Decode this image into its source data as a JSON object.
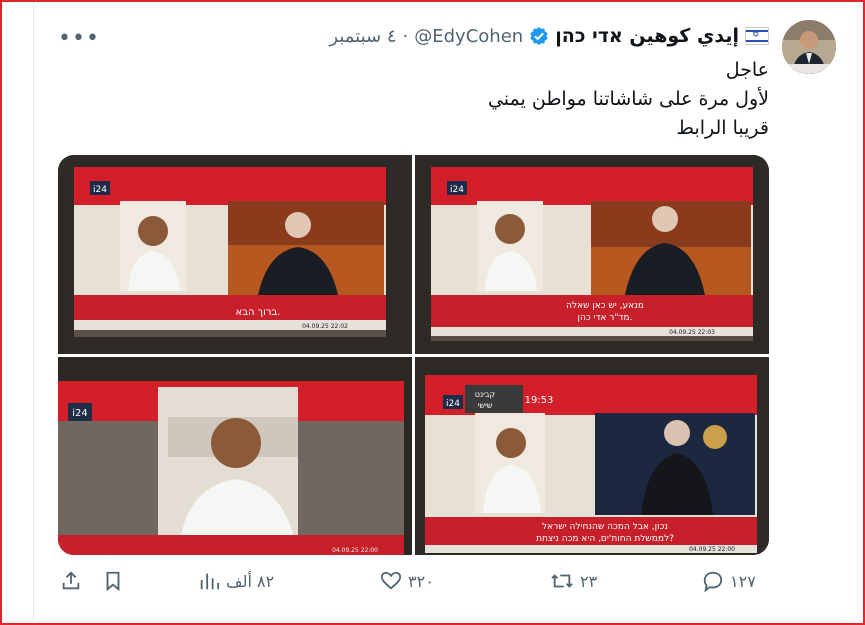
{
  "tweet": {
    "display_name": "إيدي كوهين אדי כהן",
    "handle": "@EdyCohen",
    "separator": "·",
    "date": "٤ سبتمبر",
    "lines": [
      "عاجل",
      "لأول مرة على شاشاتنا مواطن يمني",
      "قريبا الرابط"
    ]
  },
  "media": {
    "tiles": [
      {
        "logo": "i24",
        "caption": "ברוך הבא.",
        "ticker": "04.09.25   22:02"
      },
      {
        "logo": "i24",
        "caption_line1": "מנאע, יש כאן שאלה",
        "caption_line2": "מד\"ר אדי כהן.",
        "ticker": "04.09.25   22:03"
      },
      {
        "logo": "i24",
        "caption": "",
        "ticker": "04.09.25   22:00"
      },
      {
        "logo": "i24",
        "badge_line1": "קבינט",
        "badge_line2": "שישי",
        "badge_time": "19:53",
        "caption_line1": "נכון, אבל המכה שהנחילה ישראל",
        "caption_line2": "לממשלת החות'ים, היא מכה ניצחת?",
        "ticker": "04.09.25   22:00"
      }
    ]
  },
  "actions": {
    "replies": "١٢٧",
    "retweets": "٢٣",
    "likes": "٣٢٠",
    "views": "٨٢ ألف"
  },
  "colors": {
    "accent": "#1d9bf0",
    "muted": "#536471",
    "frame": "#e0262b",
    "news_red": "#c8202a"
  }
}
